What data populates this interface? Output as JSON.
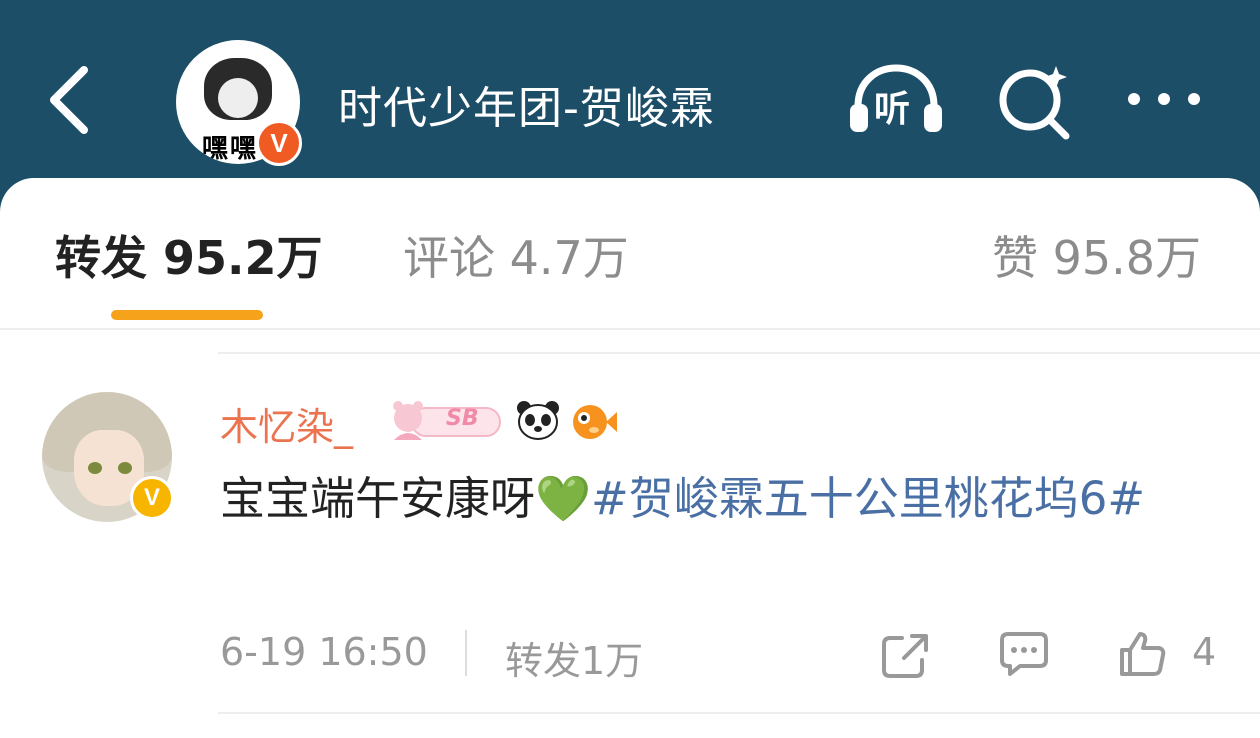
{
  "header": {
    "title": "时代少年团-贺峻霖",
    "avatar_text": "嘿嘿",
    "verified_badge": "V",
    "listen_icon_label": "听"
  },
  "tabs": [
    {
      "label": "转发 95.2万"
    },
    {
      "label": "评论 4.7万"
    },
    {
      "label": "赞 95.8万"
    }
  ],
  "comment": {
    "username": "木忆染_",
    "verified_badge": "V",
    "sticker_text": "SB",
    "text_before": "宝宝端午安康呀",
    "emoji": "💚",
    "hashtag": "#贺峻霖五十公里桃花坞6#",
    "timestamp": "6-19 16:50",
    "repost_label": "转发1万",
    "like_count": "4"
  },
  "colors": {
    "header_bg": "#1c4e68",
    "accent_underline": "#f7a21b",
    "username": "#eb7350",
    "hashtag": "#4a6fa5",
    "verified_gold": "#f7b500",
    "verified_red": "#f05a23"
  }
}
